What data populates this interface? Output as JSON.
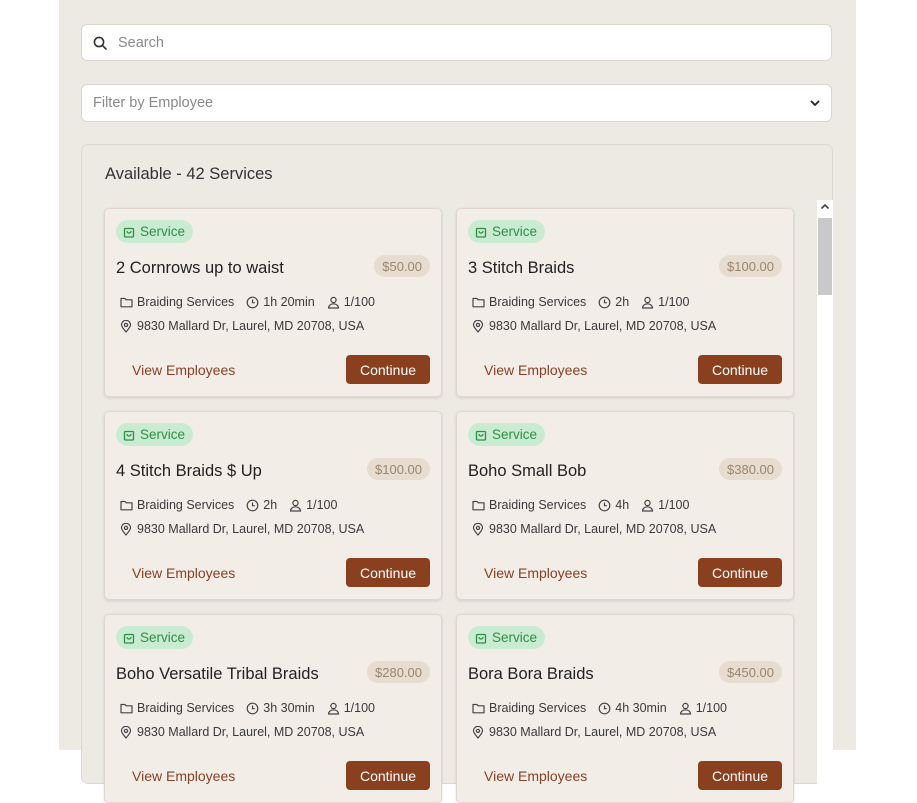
{
  "search": {
    "placeholder": "Search"
  },
  "filter": {
    "placeholder": "Filter by Employee"
  },
  "available": {
    "title": "Available - 42 Services"
  },
  "cards": [
    {
      "badge": "Service",
      "title": "2 Cornrows up to waist",
      "price": "$50.00",
      "category": "Braiding Services",
      "duration": "1h 20min",
      "capacity": "1/100",
      "address": "9830 Mallard Dr, Laurel, MD 20708, USA",
      "view_label": "View Employees",
      "continue_label": "Continue"
    },
    {
      "badge": "Service",
      "title": "3 Stitch Braids",
      "price": "$100.00",
      "category": "Braiding Services",
      "duration": "2h",
      "capacity": "1/100",
      "address": "9830 Mallard Dr, Laurel, MD 20708, USA",
      "view_label": "View Employees",
      "continue_label": "Continue"
    },
    {
      "badge": "Service",
      "title": "4 Stitch Braids $ Up",
      "price": "$100.00",
      "category": "Braiding Services",
      "duration": "2h",
      "capacity": "1/100",
      "address": "9830 Mallard Dr, Laurel, MD 20708, USA",
      "view_label": "View Employees",
      "continue_label": "Continue"
    },
    {
      "badge": "Service",
      "title": "Boho Small Bob",
      "price": "$380.00",
      "category": "Braiding Services",
      "duration": "4h",
      "capacity": "1/100",
      "address": "9830 Mallard Dr, Laurel, MD 20708, USA",
      "view_label": "View Employees",
      "continue_label": "Continue"
    },
    {
      "badge": "Service",
      "title": "Boho Versatile Tribal Braids",
      "price": "$280.00",
      "category": "Braiding Services",
      "duration": "3h 30min",
      "capacity": "1/100",
      "address": "9830 Mallard Dr, Laurel, MD 20708, USA",
      "view_label": "View Employees",
      "continue_label": "Continue"
    },
    {
      "badge": "Service",
      "title": "Bora Bora Braids",
      "price": "$450.00",
      "category": "Braiding Services",
      "duration": "4h 30min",
      "capacity": "1/100",
      "address": "9830 Mallard Dr, Laurel, MD 20708, USA",
      "view_label": "View Employees",
      "continue_label": "Continue"
    }
  ],
  "colors": {
    "accent": "#8a3f1f",
    "badge_bg": "#c9ebd1",
    "badge_text": "#2e8f44",
    "card_bg": "#f3ede8"
  }
}
